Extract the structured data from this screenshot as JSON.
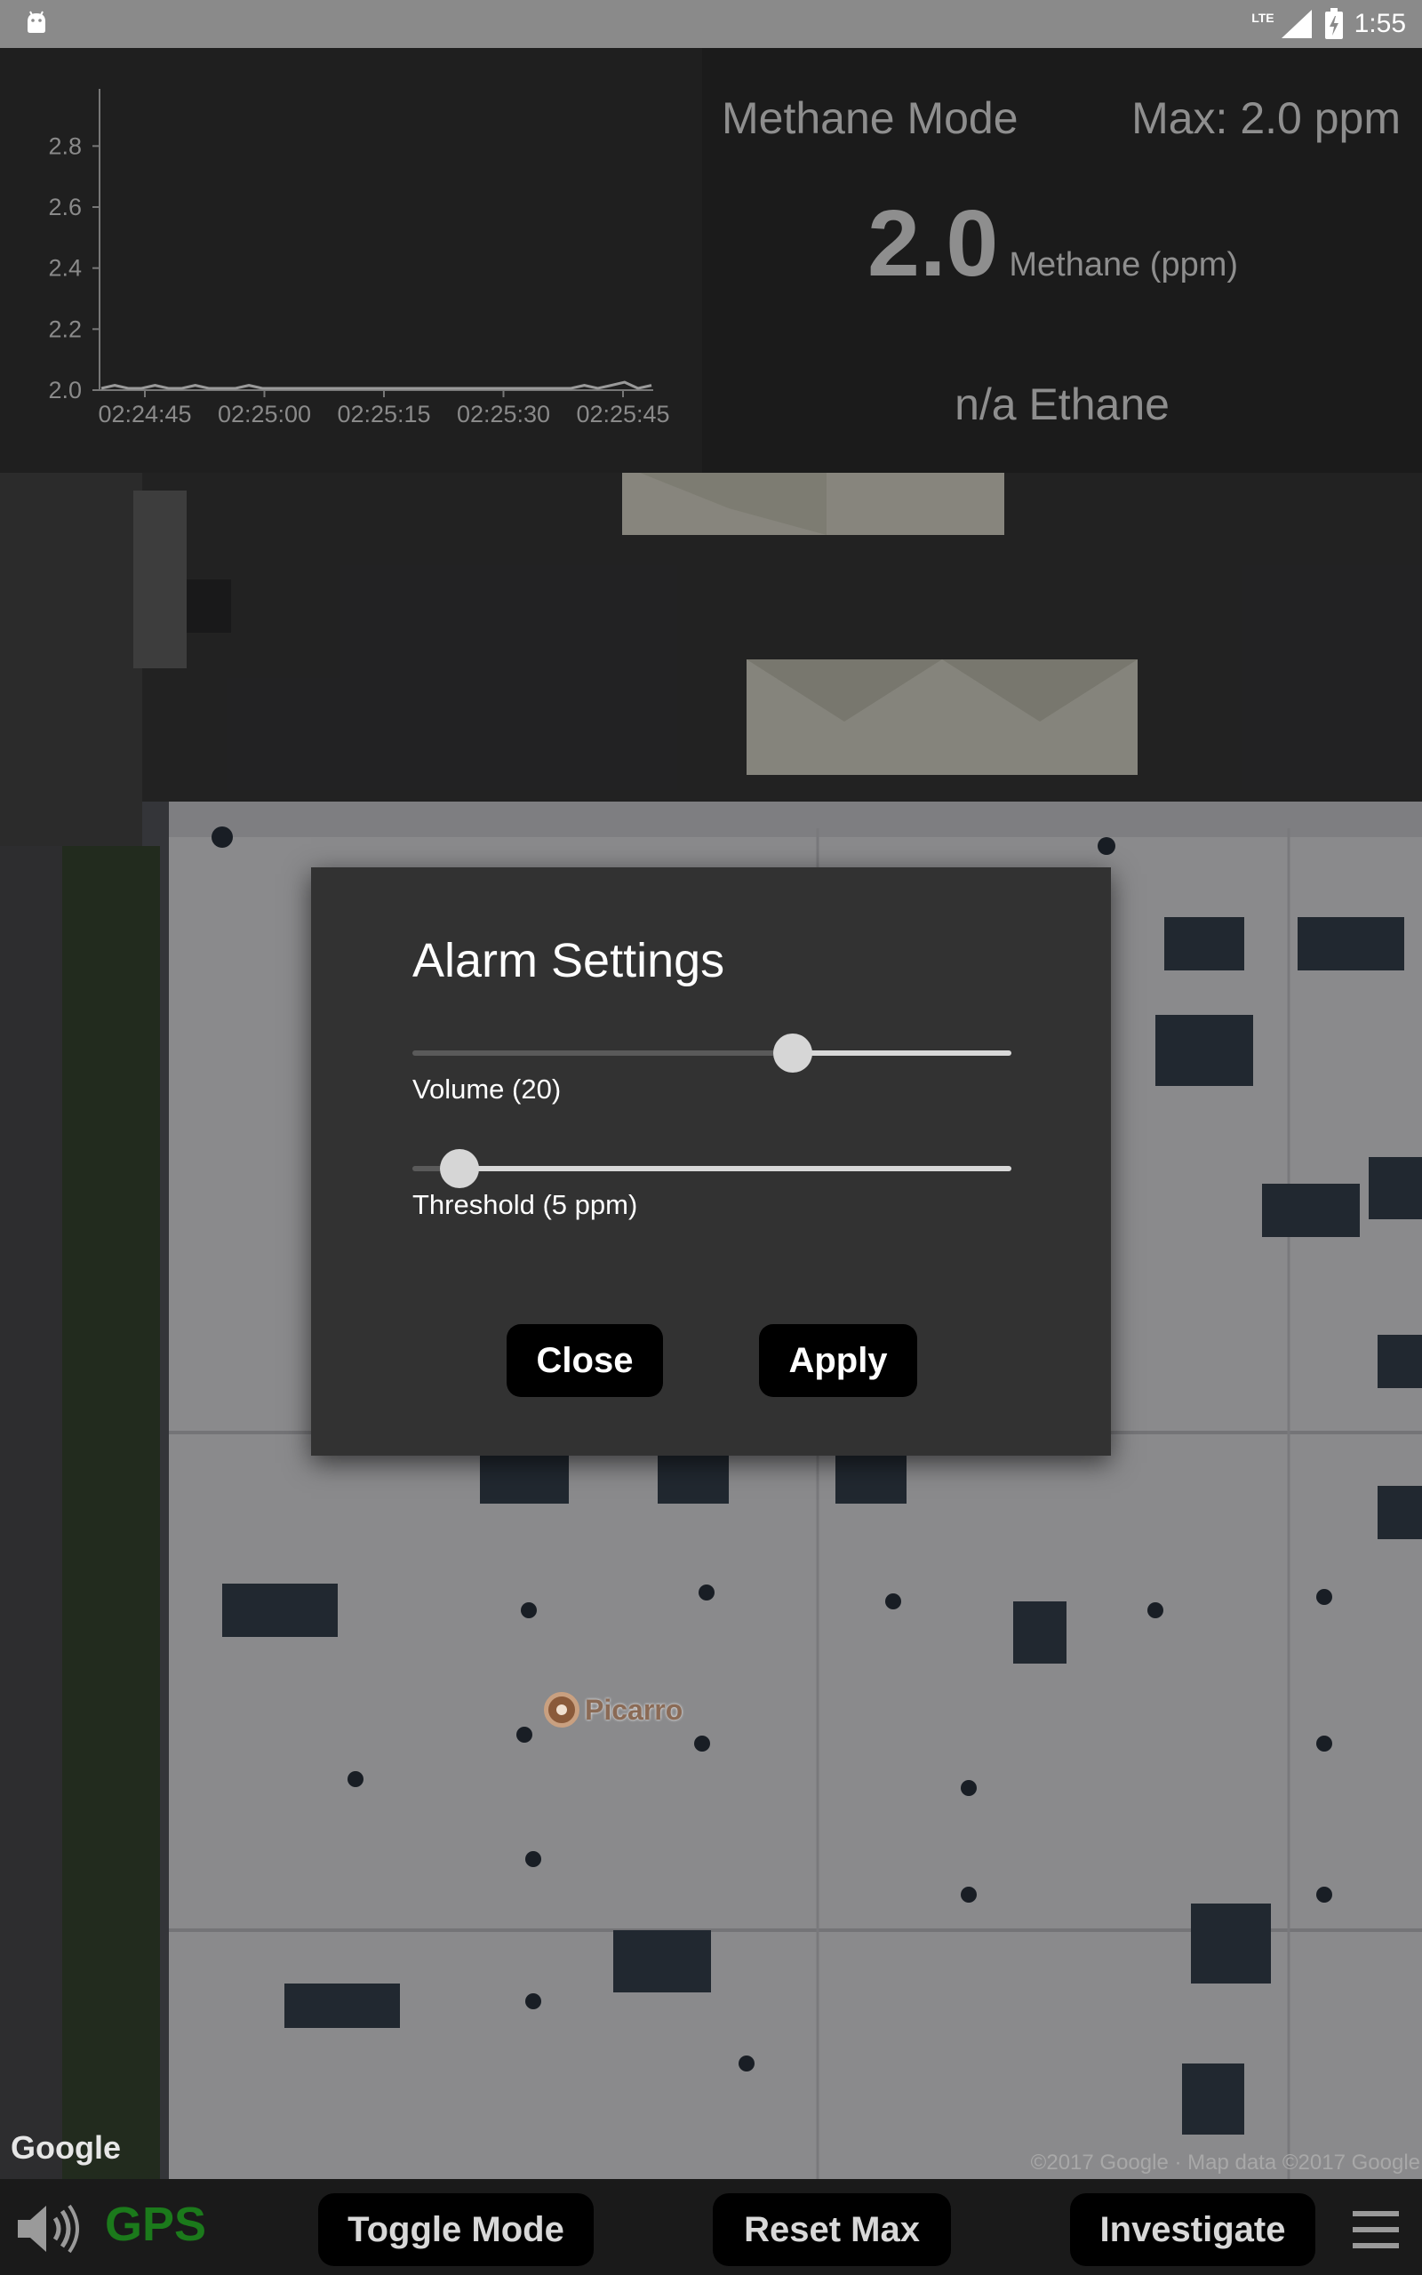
{
  "status_bar": {
    "network": "LTE",
    "time": "1:55",
    "icons": [
      "android-icon",
      "signal-icon",
      "battery-icon"
    ]
  },
  "chart_data": {
    "type": "line",
    "title": "",
    "xlabel": "",
    "ylabel": "",
    "x_tick_labels": [
      "02:24:45",
      "02:25:00",
      "02:25:15",
      "02:25:30",
      "02:25:45"
    ],
    "y_tick_labels": [
      "2.0",
      "2.2",
      "2.4",
      "2.6",
      "2.8"
    ],
    "ylim": [
      2.0,
      2.9
    ],
    "series": [
      {
        "values": [
          2.0,
          2.01,
          2.0,
          2.0,
          2.01,
          2.0,
          2.0,
          2.01,
          2.0,
          2.0,
          2.0,
          2.01,
          2.0,
          2.0,
          2.0,
          2.0,
          2.0,
          2.0,
          2.0,
          2.0,
          2.0,
          2.0,
          2.0,
          2.0,
          2.0,
          2.0,
          2.0,
          2.0,
          2.0,
          2.0,
          2.0,
          2.0,
          2.0,
          2.0,
          2.0,
          2.0,
          2.01,
          2.0,
          2.01,
          2.02,
          2.0,
          2.01
        ]
      }
    ],
    "grid": false,
    "line_color": "#9a9a9a"
  },
  "info": {
    "mode": "Methane Mode",
    "max": "Max: 2.0 ppm",
    "value": "2.0",
    "unit": "Methane (ppm)",
    "ethane": "n/a Ethane"
  },
  "map": {
    "logo": "Google",
    "copyright": "©2017 Google · Map data ©2017 Google",
    "poi_label": "Picarro"
  },
  "dialog": {
    "title": "Alarm Settings",
    "volume_label": "Volume (20)",
    "volume_fraction": 0.635,
    "threshold_label": "Threshold (5 ppm)",
    "threshold_fraction": 0.078,
    "close": "Close",
    "apply": "Apply"
  },
  "bottom_bar": {
    "gps": "GPS",
    "gps_color": "#1b7a1b",
    "toggle_mode": "Toggle Mode",
    "reset_max": "Reset Max",
    "investigate": "Investigate"
  }
}
